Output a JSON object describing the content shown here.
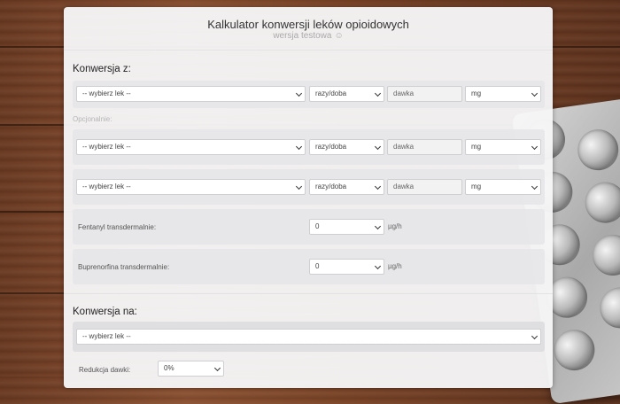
{
  "header": {
    "title": "Kalkulator konwersji leków opioidowych",
    "subtitle": "wersja testowa",
    "emoji": "☺"
  },
  "from_section": {
    "label": "Konwersja z:",
    "main_row": {
      "drug": "-- wybierz lek --",
      "frequency": "razy/doba",
      "dose_placeholder": "dawka",
      "unit": "mg"
    },
    "optional_label": "Opcjonalnie:",
    "optional_rows": [
      {
        "drug": "-- wybierz lek --",
        "frequency": "razy/doba",
        "dose_placeholder": "dawka",
        "unit": "mg"
      },
      {
        "drug": "-- wybierz lek --",
        "frequency": "razy/doba",
        "dose_placeholder": "dawka",
        "unit": "mg"
      }
    ],
    "fentanyl": {
      "label": "Fentanyl transdermalnie:",
      "value": "0",
      "unit": "µg/h"
    },
    "buprenorfina": {
      "label": "Buprenorfina transdermalnie:",
      "value": "0",
      "unit": "µg/h"
    }
  },
  "to_section": {
    "label": "Konwersja na:",
    "drug": "-- wybierz lek --"
  },
  "reduction": {
    "label": "Redukcja dawki:",
    "value": "0%"
  }
}
